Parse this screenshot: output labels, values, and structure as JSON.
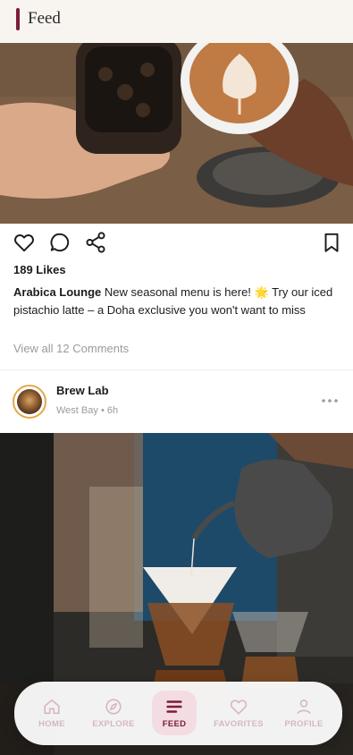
{
  "header": {
    "title": "Feed"
  },
  "post1": {
    "likes": "189 Likes",
    "author": "Arabica Lounge",
    "caption": "New seasonal menu is here! 🌟 Try our iced pistachio latte – a Doha exclusive you won't want to miss",
    "view_comments": "View all 12 Comments"
  },
  "post2": {
    "name": "Brew Lab",
    "location": "West Bay",
    "time": "6h",
    "separator": "•"
  },
  "nav": {
    "items": [
      {
        "label": "HOME",
        "icon": "home-icon"
      },
      {
        "label": "EXPLORE",
        "icon": "compass-icon"
      },
      {
        "label": "FEED",
        "icon": "feed-icon"
      },
      {
        "label": "FAVORITES",
        "icon": "heart-icon"
      },
      {
        "label": "PROFILE",
        "icon": "person-icon"
      }
    ],
    "active": "FEED"
  },
  "colors": {
    "accent": "#7c1c3a",
    "inactive_nav": "#d6b8c0",
    "muted_text": "#9b9b9b"
  }
}
